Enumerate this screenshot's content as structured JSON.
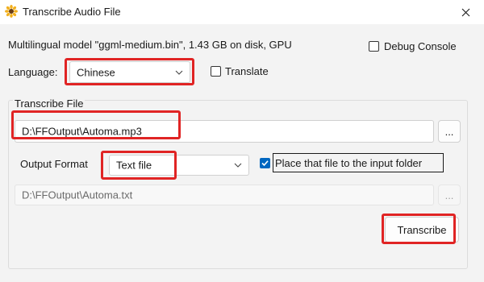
{
  "window": {
    "title": "Transcribe Audio File"
  },
  "model": {
    "info": "Multilingual model \"ggml-medium.bin\", 1.43 GB on disk, GPU"
  },
  "debug_console": {
    "label": "Debug Console",
    "checked": false
  },
  "language": {
    "label": "Language:",
    "selected": "Chinese"
  },
  "translate": {
    "label": "Translate",
    "checked": false
  },
  "transcribe_file": {
    "group_title": "Transcribe File",
    "input_path": "D:\\FFOutput\\Automa.mp3",
    "browse_label": "..."
  },
  "output": {
    "format_label": "Output Format",
    "format_selected": "Text file",
    "place_in_input_folder_label": "Place that file to the input folder",
    "place_in_input_folder_checked": true,
    "output_path": "D:\\FFOutput\\Automa.txt",
    "browse_label": "..."
  },
  "actions": {
    "transcribe_label": "Transcribe"
  },
  "colors": {
    "highlight": "#e02424",
    "accent": "#0067c0"
  },
  "icons": {
    "app": "sunflower-icon",
    "close": "close-icon",
    "chevron": "chevron-down-icon",
    "check": "checkmark-icon"
  }
}
